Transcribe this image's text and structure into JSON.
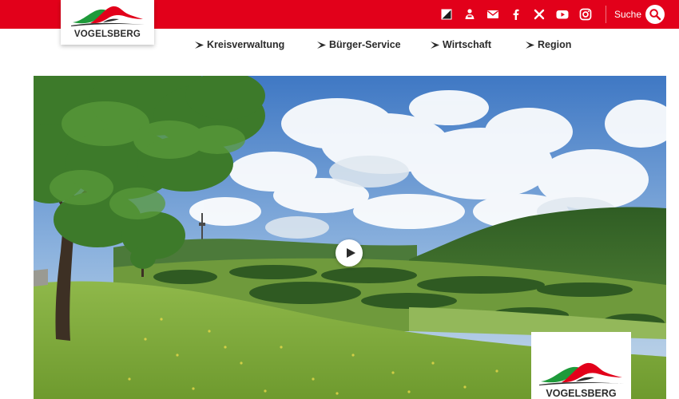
{
  "brand": {
    "name": "VOGELSBERG",
    "colors": {
      "red": "#e2001a",
      "green": "#1e9a3a",
      "dark": "#2b2b2b"
    }
  },
  "social": [
    {
      "icon": "contrast-icon",
      "label": "Kontrast"
    },
    {
      "icon": "sign-language-icon",
      "label": "Gebärdensprache"
    },
    {
      "icon": "mail-icon",
      "label": "E-Mail"
    },
    {
      "icon": "facebook-icon",
      "label": "Facebook"
    },
    {
      "icon": "x-icon",
      "label": "X"
    },
    {
      "icon": "youtube-icon",
      "label": "YouTube"
    },
    {
      "icon": "instagram-icon",
      "label": "Instagram"
    }
  ],
  "search": {
    "label": "Suche",
    "icon": "search-icon"
  },
  "nav": {
    "items": [
      {
        "label": "Kreisverwaltung"
      },
      {
        "label": "Bürger-Service"
      },
      {
        "label": "Wirtschaft"
      },
      {
        "label": "Region"
      }
    ]
  },
  "hero": {
    "type": "video",
    "play_icon": "play-icon",
    "corner_logo_text": "VOGELSBERG"
  }
}
